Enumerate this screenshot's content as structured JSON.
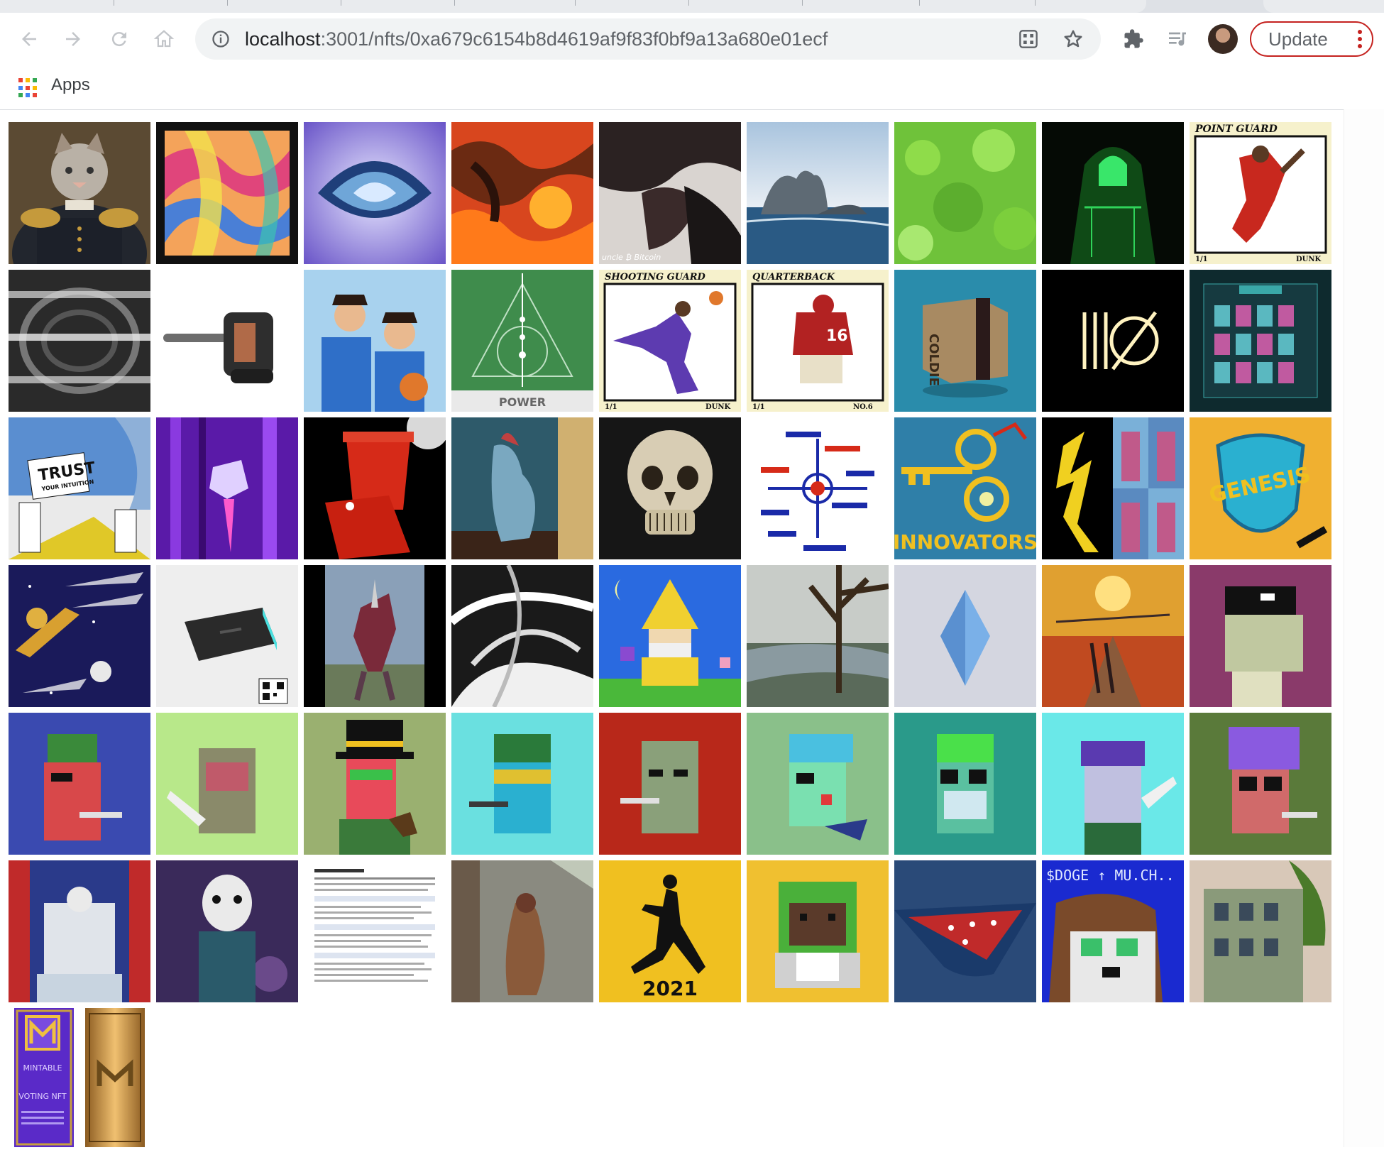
{
  "browser": {
    "url_host": "localhost",
    "url_path": ":3001/nfts/0xa679c6154b8d4619af9f83f0bf9a13a680e01ecf",
    "update_label": "Update",
    "bookmarks": [
      {
        "label": "Apps"
      }
    ]
  },
  "icons": {
    "back": "arrow-left-icon",
    "forward": "arrow-right-icon",
    "reload": "reload-icon",
    "home": "home-icon",
    "info": "info-icon",
    "qr": "qr-code-icon",
    "star": "star-icon",
    "extensions": "puzzle-icon",
    "media": "playlist-icon",
    "menu": "kebab-menu-icon",
    "apps": "apps-grid-icon"
  },
  "colors": {
    "update_border": "#c5221f",
    "omnibox": "#f1f3f4"
  },
  "tile_texts": {
    "point_guard_title": "POINT GUARD",
    "point_guard_l": "1/1",
    "point_guard_r": "DUNK",
    "power": "POWER",
    "shooting_guard_title": "SHOOTING GUARD",
    "shooting_guard_l": "1/1",
    "shooting_guard_r": "DUNK",
    "qb_title": "QUARTERBACK",
    "qb_l": "1/1",
    "qb_r": "NO.6",
    "qb_num": "16",
    "coldie": "COLDIE",
    "uncle": "uncle ₿ Bitcoin",
    "trust": "TRUST",
    "trust_sub": "YOUR INTUITION",
    "innovators": "INNOVATORS",
    "genesis": "GENESIS",
    "jordan_year": "2021",
    "doge": "$DOGE ↑ MU.CH..",
    "mintable_1": "MINTABLE",
    "mintable_2": "VOTING NFT"
  }
}
